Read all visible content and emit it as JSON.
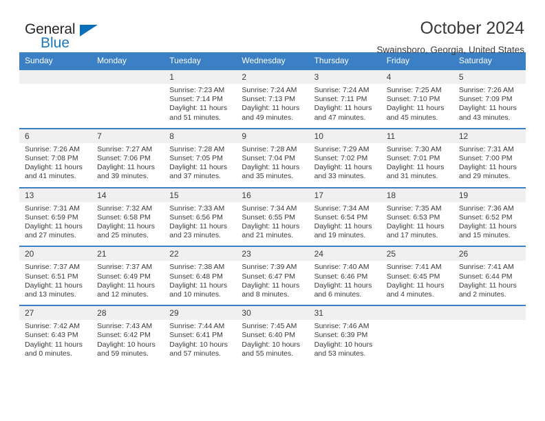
{
  "logo": {
    "word_one": "General",
    "word_two": "Blue",
    "triangle_color": "#0b6fba",
    "blue_text_color": "#1878bd"
  },
  "header": {
    "title": "October 2024",
    "location": "Swainsboro, Georgia, United States"
  },
  "theme": {
    "header_blue": "#3b7fc4",
    "daynum_band": "#f0f0f0",
    "text": "#3a3a3a"
  },
  "calendar": {
    "weekday_headers": [
      "Sunday",
      "Monday",
      "Tuesday",
      "Wednesday",
      "Thursday",
      "Friday",
      "Saturday"
    ],
    "weeks": [
      [
        {
          "day": "",
          "sunrise": "",
          "sunset": "",
          "daylight": ""
        },
        {
          "day": "",
          "sunrise": "",
          "sunset": "",
          "daylight": ""
        },
        {
          "day": "1",
          "sunrise": "Sunrise: 7:23 AM",
          "sunset": "Sunset: 7:14 PM",
          "daylight": "Daylight: 11 hours and 51 minutes."
        },
        {
          "day": "2",
          "sunrise": "Sunrise: 7:24 AM",
          "sunset": "Sunset: 7:13 PM",
          "daylight": "Daylight: 11 hours and 49 minutes."
        },
        {
          "day": "3",
          "sunrise": "Sunrise: 7:24 AM",
          "sunset": "Sunset: 7:11 PM",
          "daylight": "Daylight: 11 hours and 47 minutes."
        },
        {
          "day": "4",
          "sunrise": "Sunrise: 7:25 AM",
          "sunset": "Sunset: 7:10 PM",
          "daylight": "Daylight: 11 hours and 45 minutes."
        },
        {
          "day": "5",
          "sunrise": "Sunrise: 7:26 AM",
          "sunset": "Sunset: 7:09 PM",
          "daylight": "Daylight: 11 hours and 43 minutes."
        }
      ],
      [
        {
          "day": "6",
          "sunrise": "Sunrise: 7:26 AM",
          "sunset": "Sunset: 7:08 PM",
          "daylight": "Daylight: 11 hours and 41 minutes."
        },
        {
          "day": "7",
          "sunrise": "Sunrise: 7:27 AM",
          "sunset": "Sunset: 7:06 PM",
          "daylight": "Daylight: 11 hours and 39 minutes."
        },
        {
          "day": "8",
          "sunrise": "Sunrise: 7:28 AM",
          "sunset": "Sunset: 7:05 PM",
          "daylight": "Daylight: 11 hours and 37 minutes."
        },
        {
          "day": "9",
          "sunrise": "Sunrise: 7:28 AM",
          "sunset": "Sunset: 7:04 PM",
          "daylight": "Daylight: 11 hours and 35 minutes."
        },
        {
          "day": "10",
          "sunrise": "Sunrise: 7:29 AM",
          "sunset": "Sunset: 7:02 PM",
          "daylight": "Daylight: 11 hours and 33 minutes."
        },
        {
          "day": "11",
          "sunrise": "Sunrise: 7:30 AM",
          "sunset": "Sunset: 7:01 PM",
          "daylight": "Daylight: 11 hours and 31 minutes."
        },
        {
          "day": "12",
          "sunrise": "Sunrise: 7:31 AM",
          "sunset": "Sunset: 7:00 PM",
          "daylight": "Daylight: 11 hours and 29 minutes."
        }
      ],
      [
        {
          "day": "13",
          "sunrise": "Sunrise: 7:31 AM",
          "sunset": "Sunset: 6:59 PM",
          "daylight": "Daylight: 11 hours and 27 minutes."
        },
        {
          "day": "14",
          "sunrise": "Sunrise: 7:32 AM",
          "sunset": "Sunset: 6:58 PM",
          "daylight": "Daylight: 11 hours and 25 minutes."
        },
        {
          "day": "15",
          "sunrise": "Sunrise: 7:33 AM",
          "sunset": "Sunset: 6:56 PM",
          "daylight": "Daylight: 11 hours and 23 minutes."
        },
        {
          "day": "16",
          "sunrise": "Sunrise: 7:34 AM",
          "sunset": "Sunset: 6:55 PM",
          "daylight": "Daylight: 11 hours and 21 minutes."
        },
        {
          "day": "17",
          "sunrise": "Sunrise: 7:34 AM",
          "sunset": "Sunset: 6:54 PM",
          "daylight": "Daylight: 11 hours and 19 minutes."
        },
        {
          "day": "18",
          "sunrise": "Sunrise: 7:35 AM",
          "sunset": "Sunset: 6:53 PM",
          "daylight": "Daylight: 11 hours and 17 minutes."
        },
        {
          "day": "19",
          "sunrise": "Sunrise: 7:36 AM",
          "sunset": "Sunset: 6:52 PM",
          "daylight": "Daylight: 11 hours and 15 minutes."
        }
      ],
      [
        {
          "day": "20",
          "sunrise": "Sunrise: 7:37 AM",
          "sunset": "Sunset: 6:51 PM",
          "daylight": "Daylight: 11 hours and 13 minutes."
        },
        {
          "day": "21",
          "sunrise": "Sunrise: 7:37 AM",
          "sunset": "Sunset: 6:49 PM",
          "daylight": "Daylight: 11 hours and 12 minutes."
        },
        {
          "day": "22",
          "sunrise": "Sunrise: 7:38 AM",
          "sunset": "Sunset: 6:48 PM",
          "daylight": "Daylight: 11 hours and 10 minutes."
        },
        {
          "day": "23",
          "sunrise": "Sunrise: 7:39 AM",
          "sunset": "Sunset: 6:47 PM",
          "daylight": "Daylight: 11 hours and 8 minutes."
        },
        {
          "day": "24",
          "sunrise": "Sunrise: 7:40 AM",
          "sunset": "Sunset: 6:46 PM",
          "daylight": "Daylight: 11 hours and 6 minutes."
        },
        {
          "day": "25",
          "sunrise": "Sunrise: 7:41 AM",
          "sunset": "Sunset: 6:45 PM",
          "daylight": "Daylight: 11 hours and 4 minutes."
        },
        {
          "day": "26",
          "sunrise": "Sunrise: 7:41 AM",
          "sunset": "Sunset: 6:44 PM",
          "daylight": "Daylight: 11 hours and 2 minutes."
        }
      ],
      [
        {
          "day": "27",
          "sunrise": "Sunrise: 7:42 AM",
          "sunset": "Sunset: 6:43 PM",
          "daylight": "Daylight: 11 hours and 0 minutes."
        },
        {
          "day": "28",
          "sunrise": "Sunrise: 7:43 AM",
          "sunset": "Sunset: 6:42 PM",
          "daylight": "Daylight: 10 hours and 59 minutes."
        },
        {
          "day": "29",
          "sunrise": "Sunrise: 7:44 AM",
          "sunset": "Sunset: 6:41 PM",
          "daylight": "Daylight: 10 hours and 57 minutes."
        },
        {
          "day": "30",
          "sunrise": "Sunrise: 7:45 AM",
          "sunset": "Sunset: 6:40 PM",
          "daylight": "Daylight: 10 hours and 55 minutes."
        },
        {
          "day": "31",
          "sunrise": "Sunrise: 7:46 AM",
          "sunset": "Sunset: 6:39 PM",
          "daylight": "Daylight: 10 hours and 53 minutes."
        },
        {
          "day": "",
          "sunrise": "",
          "sunset": "",
          "daylight": ""
        },
        {
          "day": "",
          "sunrise": "",
          "sunset": "",
          "daylight": ""
        }
      ]
    ]
  }
}
